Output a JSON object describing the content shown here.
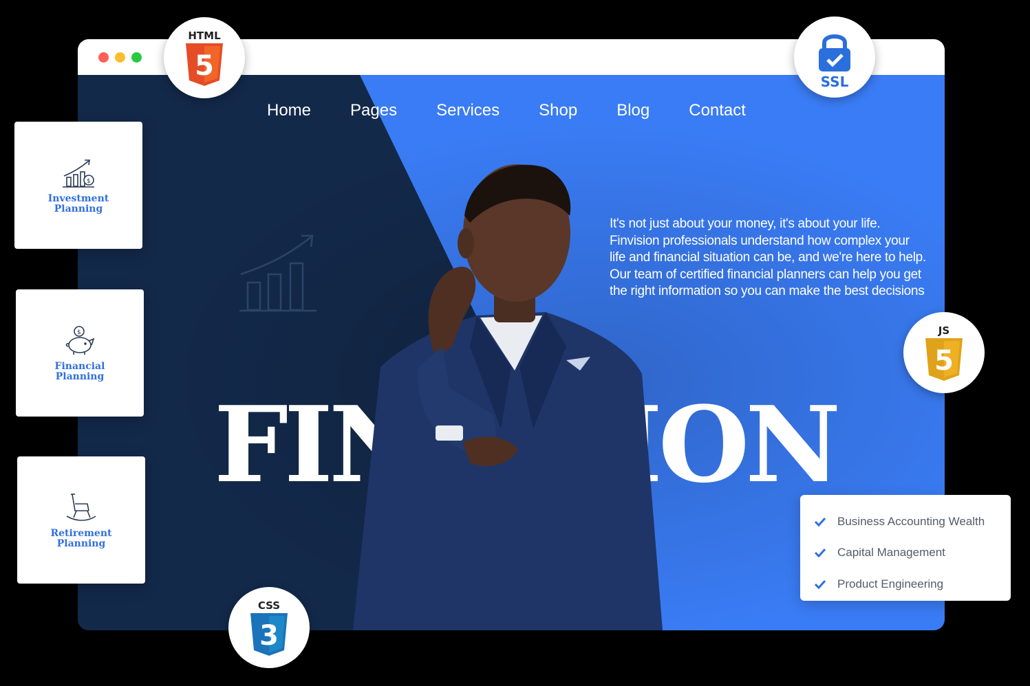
{
  "nav": {
    "items": [
      {
        "label": "Home"
      },
      {
        "label": "Pages"
      },
      {
        "label": "Services"
      },
      {
        "label": "Shop"
      },
      {
        "label": "Blog"
      },
      {
        "label": "Contact"
      }
    ]
  },
  "hero": {
    "tagline": "It's not just about your money, it's about your life. Finvision professionals understand how complex your life and financial situation can be, and we're here to help. Our team of certified financial planners can help you get the right information so you can make the best decisions",
    "brand": "FINVISION"
  },
  "cards": [
    {
      "label": "Investment Planning",
      "icon": "growth-chart-icon"
    },
    {
      "label": "Financial Planning",
      "icon": "piggy-bank-icon"
    },
    {
      "label": "Retirement Planning",
      "icon": "rocking-chair-icon"
    }
  ],
  "badges": {
    "html": "HTML",
    "ssl": "SSL",
    "js": "JS",
    "css": "CSS",
    "html_num": "5",
    "js_num": "5",
    "css_num": "3"
  },
  "features": [
    {
      "label": "Business Accounting Wealth"
    },
    {
      "label": "Capital Management"
    },
    {
      "label": "Product Engineering"
    }
  ],
  "colors": {
    "navy": "#13294a",
    "blue": "#3a7cf5",
    "card_label": "#2f6fe0",
    "html_orange": "#e44d26",
    "js_yellow": "#f0b024",
    "css_blue": "#1b73ba",
    "ssl_blue": "#2a6fdb"
  }
}
